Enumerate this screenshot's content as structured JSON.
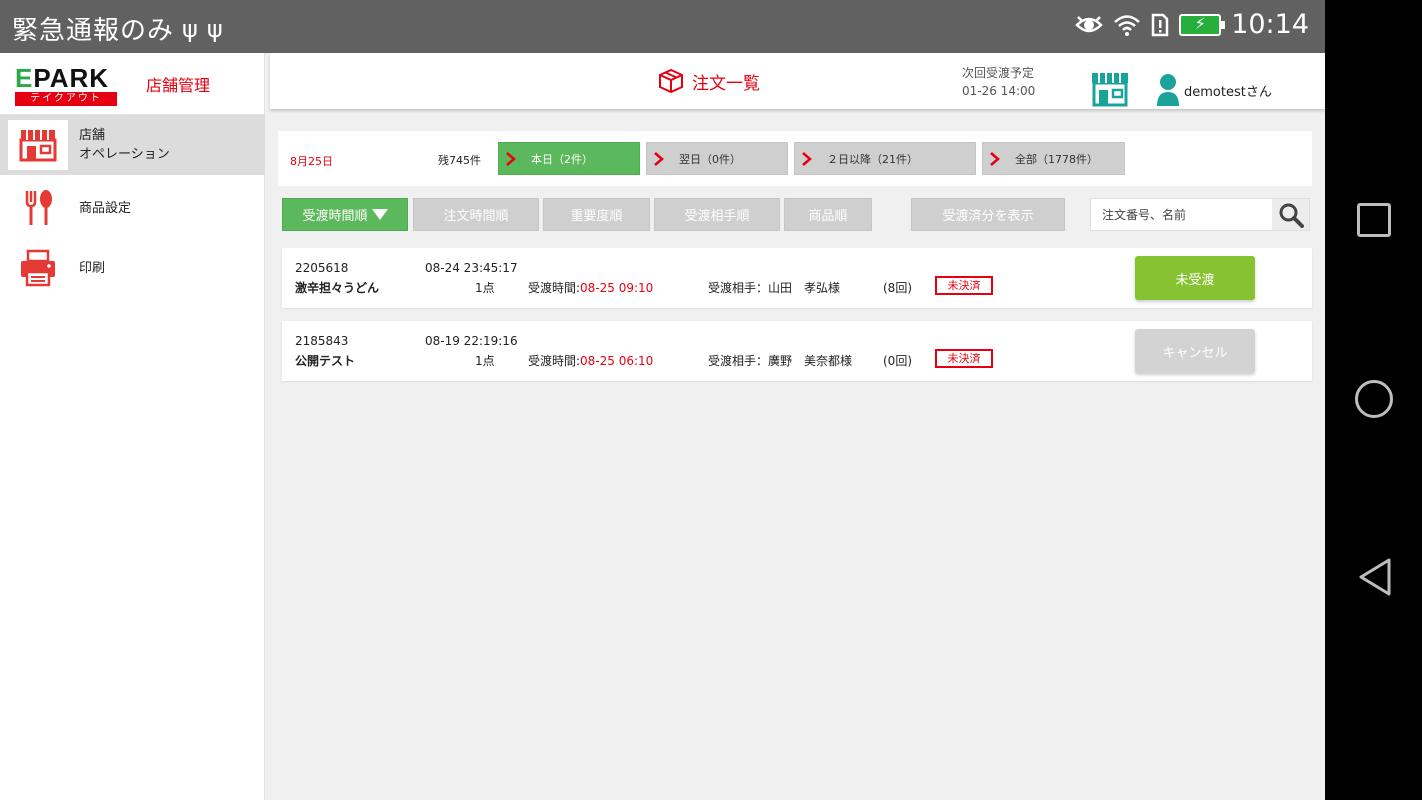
{
  "statusbar": {
    "left_text": "緊急通報のみ",
    "clock": "10:14"
  },
  "sidebar": {
    "brand": "EPARK",
    "brand_sub": "テイクアウト",
    "section": "店舗管理",
    "items": [
      {
        "label_line1": "店舗",
        "label_line2": "オペレーション",
        "icon": "storefront-icon"
      },
      {
        "label": "商品設定",
        "icon": "fork-spoon-icon"
      },
      {
        "label": "印刷",
        "icon": "printer-icon"
      }
    ]
  },
  "header": {
    "title": "注文一覧",
    "next_label": "次回受渡予定",
    "next_time": "01-26 14:00",
    "user": "demotestさん"
  },
  "datebar": {
    "date": "8月25日",
    "remaining": "残745件",
    "tabs": [
      {
        "label": "本日（2件）"
      },
      {
        "label": "翌日（0件）"
      },
      {
        "label": "２日以降（21件）"
      },
      {
        "label": "全部（1778件）"
      }
    ]
  },
  "sort": {
    "buttons": [
      {
        "label": "受渡時間順"
      },
      {
        "label": "注文時間順"
      },
      {
        "label": "重要度順"
      },
      {
        "label": "受渡相手順"
      },
      {
        "label": "商品順"
      }
    ],
    "show_delivered": "受渡済分を表示",
    "search_placeholder": "注文番号、名前"
  },
  "orders": [
    {
      "id": "2205618",
      "name": "激辛担々うどん",
      "order_time": "08-24 23:45:17",
      "qty": "1点",
      "receive_label": "受渡時間:",
      "receive_time": "08-25 09:10",
      "partner": "受渡相手：山田　孝弘様",
      "count": "(8回)",
      "payment": "未決済",
      "action": "未受渡"
    },
    {
      "id": "2185843",
      "name": "公開テスト",
      "order_time": "08-19 22:19:16",
      "qty": "1点",
      "receive_label": "受渡時間:",
      "receive_time": "08-25 06:10",
      "partner": "受渡相手：廣野　美奈都様",
      "count": "(0回)",
      "payment": "未決済",
      "action": "キャンセル"
    }
  ],
  "colors": {
    "brand_red": "#e60012",
    "active_green": "#5cb85c",
    "action_green": "#86c232",
    "status_bar": "#616161"
  }
}
